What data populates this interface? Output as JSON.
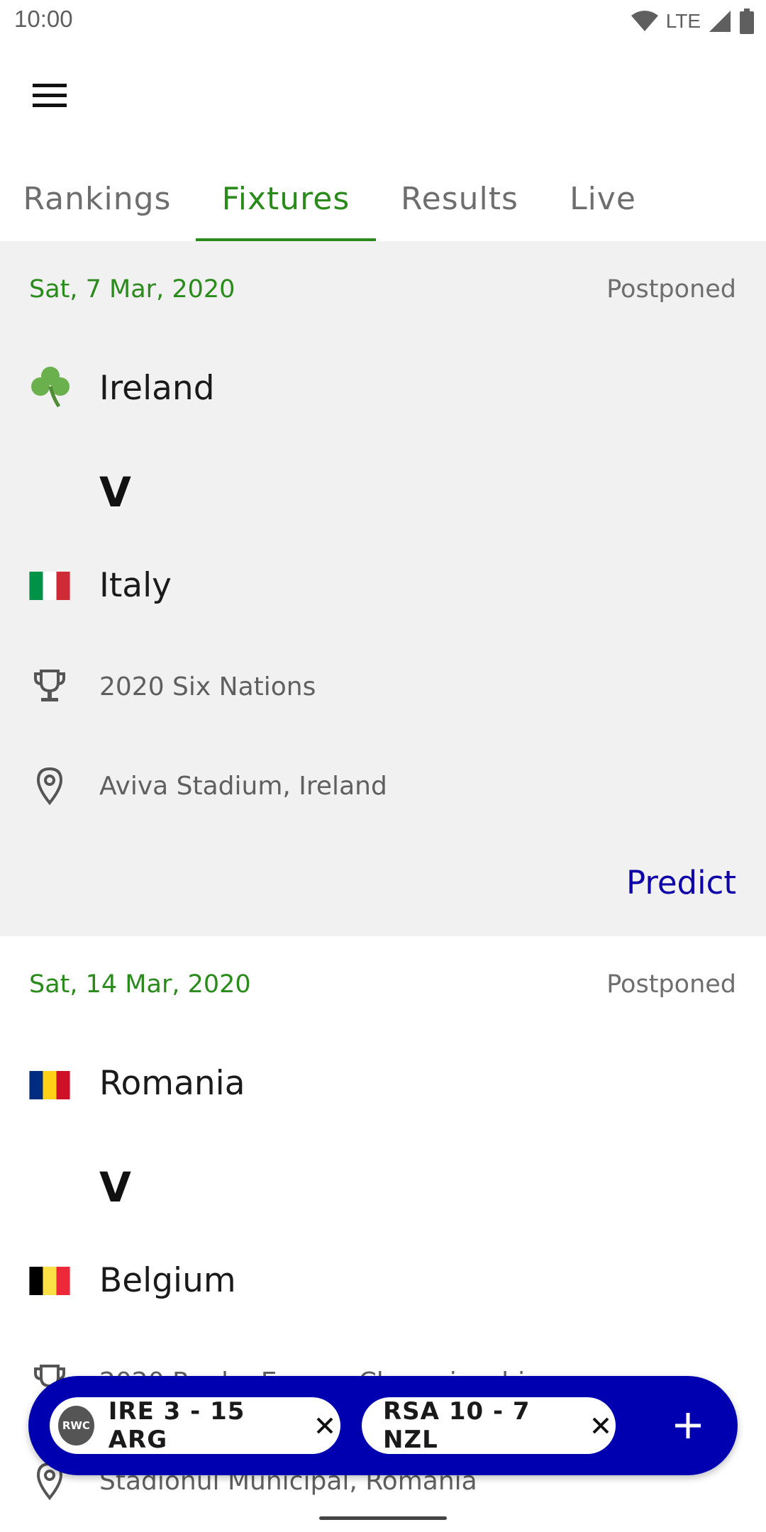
{
  "status_bar": {
    "time": "10:00",
    "network": "LTE"
  },
  "tabs": [
    {
      "label": "Rankings"
    },
    {
      "label": "Fixtures"
    },
    {
      "label": "Results"
    },
    {
      "label": "Live"
    }
  ],
  "active_tab": "Fixtures",
  "fixtures": [
    {
      "date": "Sat, 7 Mar, 2020",
      "status": "Postponed",
      "home": {
        "name": "Ireland",
        "flag": "shamrock-icon"
      },
      "versus": "V",
      "away": {
        "name": "Italy",
        "flag": "italy-flag"
      },
      "competition": "2020 Six Nations",
      "venue": "Aviva Stadium, Ireland",
      "action": "Predict"
    },
    {
      "date": "Sat, 14 Mar, 2020",
      "status": "Postponed",
      "home": {
        "name": "Romania",
        "flag": "romania-flag"
      },
      "versus": "V",
      "away": {
        "name": "Belgium",
        "flag": "belgium-flag"
      },
      "competition": "2020 Rugby Europe Championship",
      "venue": "Stadionul Municipal, Romania"
    }
  ],
  "live_bar": {
    "chips": [
      {
        "badge": "RWC",
        "text": "IRE 3 - 15 ARG"
      },
      {
        "text": "RSA 10 - 7 NZL"
      }
    ]
  },
  "colors": {
    "accent_green": "#2a8a1c",
    "predict_blue": "#0d00a8",
    "live_bar_blue": "#0000b0",
    "card_grey": "#f1f1f1"
  }
}
